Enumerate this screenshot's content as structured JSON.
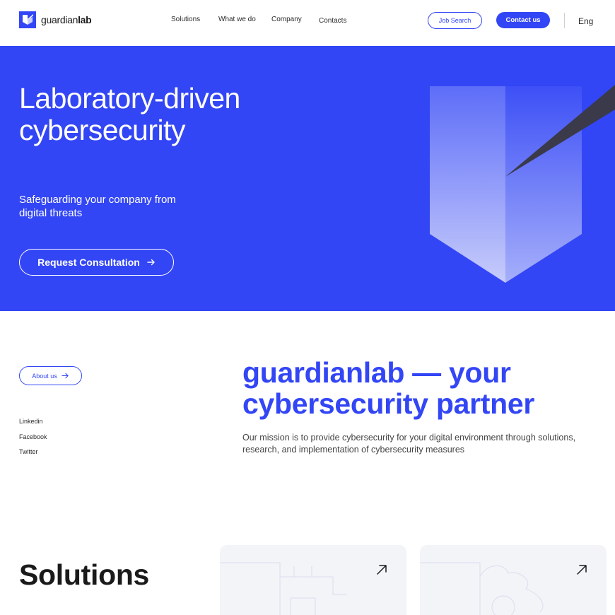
{
  "brand": {
    "name_light": "guardian",
    "name_bold": "lab"
  },
  "nav": {
    "items": [
      {
        "label": "Solutions"
      },
      {
        "label": "What we do"
      },
      {
        "label": "Company"
      },
      {
        "label": "Contacts"
      }
    ]
  },
  "header": {
    "job_search_label": "Job Search",
    "contact_label": "Contact us",
    "language": "Eng"
  },
  "hero": {
    "title": "Laboratory-driven cybersecurity",
    "subtitle": "Safeguarding your company from digital threats",
    "cta_label": "Request Consultation"
  },
  "about": {
    "button_label": "About us",
    "social": [
      "Linkedin",
      "Facebook",
      "Twitter"
    ],
    "title": "guardianlab — your cybersecurity partner",
    "text": "Our mission is to provide cybersecurity for your digital environment through solutions, research, and implementation of cybersecurity measures"
  },
  "solutions": {
    "title": "Solutions"
  },
  "colors": {
    "accent": "#3346f5",
    "card_bg": "#f3f4f8",
    "dark_shape": "#3a3a4a"
  },
  "icons": [
    "logo-icon",
    "arrow-right-icon",
    "arrow-up-right-icon"
  ]
}
